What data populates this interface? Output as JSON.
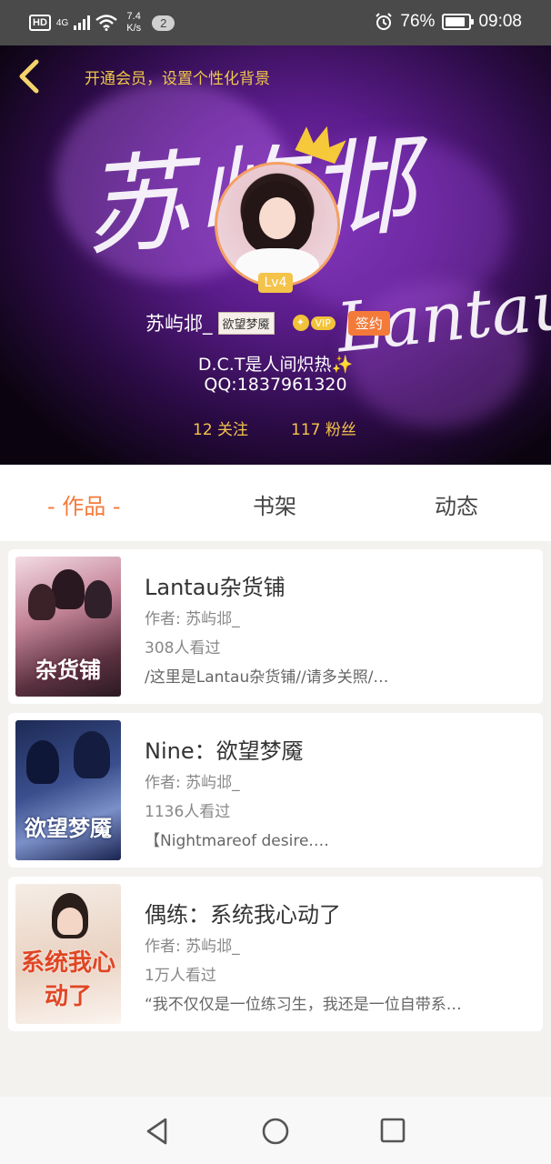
{
  "status_bar": {
    "hd": "HD",
    "network": "4G",
    "speed_value": "7.4",
    "speed_unit": "K/s",
    "notification_count": "2",
    "battery": "76%",
    "time": "09:08"
  },
  "header": {
    "vip_promo": "开通会员，设置个性化背景",
    "background_title": "苏屿邶",
    "background_subtitle": "Lantau",
    "level": "Lv4",
    "nickname": "苏屿邶_",
    "tag": "欲望梦魇",
    "vip_label": "VIP",
    "signed_label": "签约",
    "bio_line1": "D.C.T是人间炽热",
    "bio_sparkle": "✨",
    "bio_line2": "QQ:1837961320",
    "following": "12 关注",
    "followers": "117 粉丝"
  },
  "tabs": [
    {
      "label": "- 作品 -",
      "active": true
    },
    {
      "label": "书架",
      "active": false
    },
    {
      "label": "动态",
      "active": false
    }
  ],
  "works": [
    {
      "title": "Lantau杂货铺",
      "author": "作者: 苏屿邶_",
      "views": "308人看过",
      "desc": "/这里是Lantau杂货铺//请多关照/…",
      "cover_text": "杂货铺"
    },
    {
      "title": "Nine：欲望梦魇",
      "author": "作者: 苏屿邶_",
      "views": "1136人看过",
      "desc": "【Nightmareof desire.…",
      "cover_text": "欲望梦魇"
    },
    {
      "title": "偶练：系统我心动了",
      "author": "作者: 苏屿邶_",
      "views": "1万人看过",
      "desc": "“我不仅仅是一位练习生，我还是一位自带系…",
      "cover_text": "系统我心动了"
    }
  ],
  "colors": {
    "accent": "#f47a3a",
    "gold": "#f4c34a",
    "status_bar": "#4a4a4a"
  }
}
